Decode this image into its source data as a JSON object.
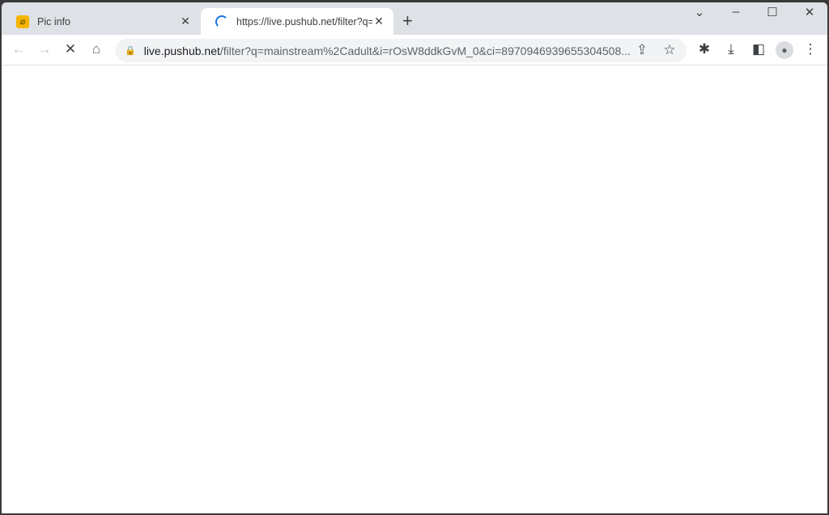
{
  "tabs": [
    {
      "title": "Pic info",
      "active": false,
      "favicon": "pic-info-icon"
    },
    {
      "title": "https://live.pushub.net/filter?q=m",
      "active": true,
      "loading": true
    }
  ],
  "omnibox": {
    "host": "live.pushub.net",
    "path": "/filter?q=mainstream%2Cadult&i=rOsW8ddkGvM_0&ci=8970946939655304508..."
  },
  "icons": {
    "back": "←",
    "forward": "→",
    "stop": "✕",
    "home": "⌂",
    "share": "⇪",
    "star": "☆",
    "extensions": "✱",
    "download": "⤓",
    "sidepanel": "◧",
    "profile": "●",
    "menu": "⋮",
    "new_tab": "+",
    "tab_search": "⌄",
    "minimize": "–",
    "maximize": "☐",
    "close": "✕"
  },
  "accent": "#1a73e8"
}
